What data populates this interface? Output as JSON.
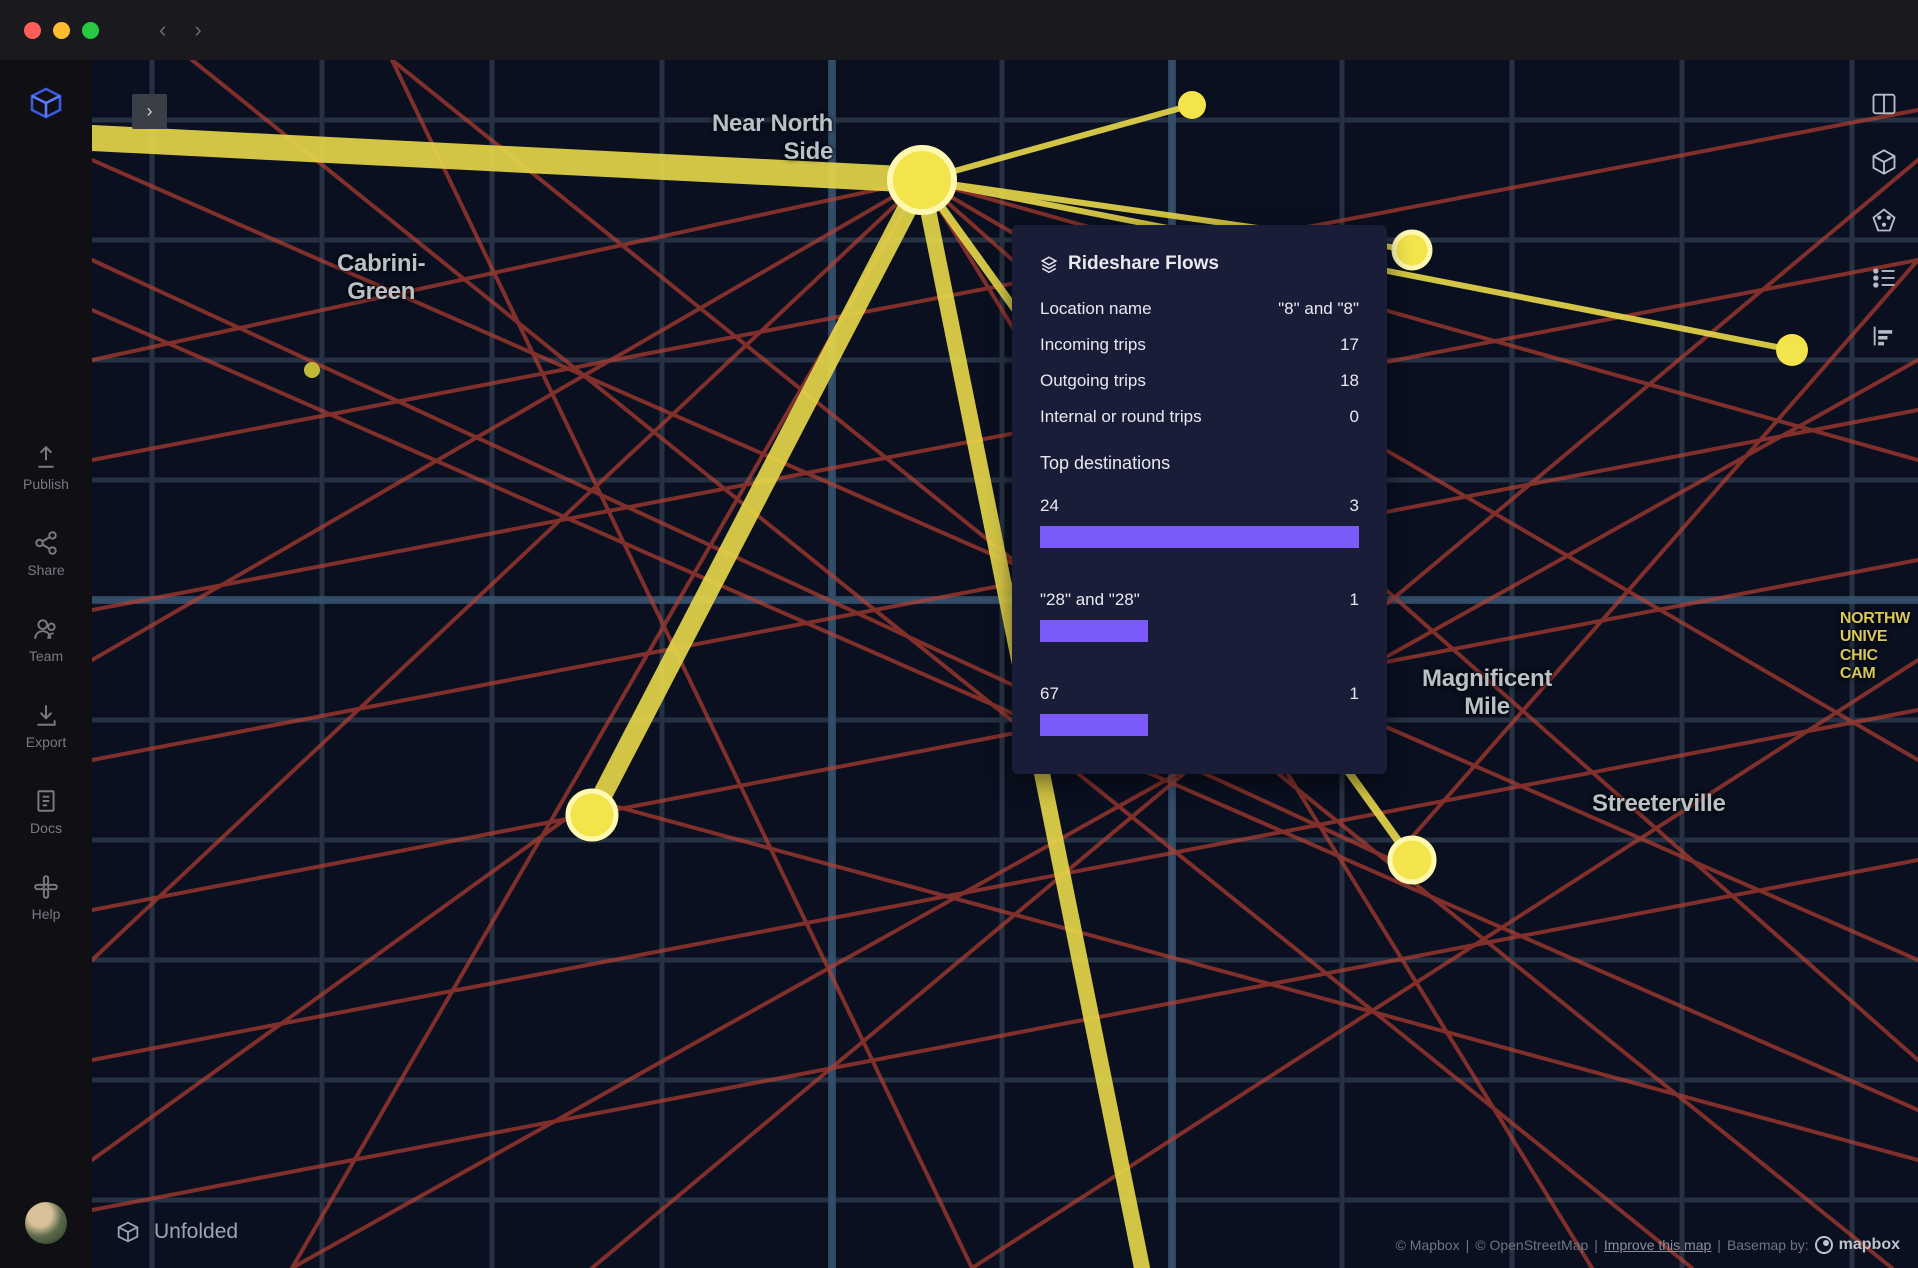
{
  "sidebar_left": {
    "items": [
      {
        "key": "publish",
        "label": "Publish"
      },
      {
        "key": "share",
        "label": "Share"
      },
      {
        "key": "team",
        "label": "Team"
      },
      {
        "key": "export",
        "label": "Export"
      },
      {
        "key": "docs",
        "label": "Docs"
      },
      {
        "key": "help",
        "label": "Help"
      }
    ]
  },
  "map": {
    "labels": {
      "near_north_side": "Near North\nSide",
      "cabrini_green": "Cabrini-\nGreen",
      "magnificent_mile": "Magnificent\nMile",
      "streeterville": "Streeterville",
      "northwestern_campus": "NORTHW\nUNIVE\nCHIC\nCAM"
    }
  },
  "tooltip": {
    "title": "Rideshare Flows",
    "rows": [
      {
        "label": "Location name",
        "value": "\"8\" and \"8\""
      },
      {
        "label": "Incoming trips",
        "value": "17"
      },
      {
        "label": "Outgoing trips",
        "value": "18"
      },
      {
        "label": "Internal or round trips",
        "value": "0"
      }
    ],
    "section_title": "Top destinations",
    "destinations": [
      {
        "label": "24",
        "value": "3",
        "ratio": 1.0
      },
      {
        "label": "\"28\" and \"28\"",
        "value": "1",
        "ratio": 0.34
      },
      {
        "label": "67",
        "value": "1",
        "ratio": 0.34
      }
    ],
    "bar_color": "#7a5af8"
  },
  "footer": {
    "brand": "Unfolded",
    "attribution": {
      "mapbox": "© Mapbox",
      "osm": "© OpenStreetMap",
      "improve": "Improve this map",
      "basemap_by": "Basemap by:",
      "provider": "mapbox"
    }
  }
}
